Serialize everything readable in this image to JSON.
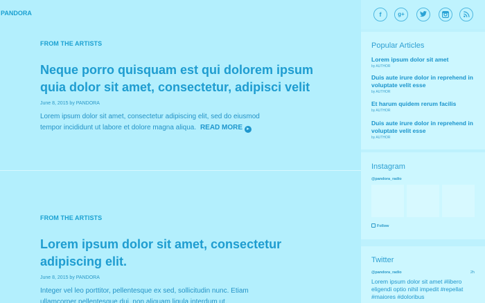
{
  "brand": {
    "logo": "PANDORA"
  },
  "articles": [
    {
      "category": "FROM THE ARTISTS",
      "title": "Neque porro quisquam est qui dolorem ipsum quia dolor sit amet, consectetur, adipisci velit",
      "meta": "June 8, 2015 by PANDORA",
      "excerpt": "Lorem ipsum dolor sit amet, consectetur adipiscing elit, sed do eiusmod tempor incididunt ut labore et dolore magna aliqua.",
      "read_more": "READ MORE"
    },
    {
      "category": "FROM THE ARTISTS",
      "title": "Lorem ipsum dolor sit amet, consectetur adipiscing elit.",
      "meta": "June 8, 2015 by PANDORA",
      "excerpt": "Integer vel leo porttitor, pellentesque ex sed, sollicitudin nunc. Etiam ullamcorper pellentesque dui, non aliquam ligula interdum ut."
    }
  ],
  "social": [
    {
      "icon": "facebook-icon",
      "glyph": "f"
    },
    {
      "icon": "google-plus-icon",
      "glyph": "g+"
    },
    {
      "icon": "twitter-icon",
      "glyph": ""
    },
    {
      "icon": "instagram-icon",
      "glyph": ""
    },
    {
      "icon": "rss-icon",
      "glyph": ""
    }
  ],
  "popular": {
    "title": "Popular Articles",
    "items": [
      {
        "title": "Lorem ipsum dolor sit amet",
        "by": "by AUTHOR"
      },
      {
        "title": "Duis aute irure dolor in reprehend in voluptate velit esse",
        "by": "by AUTHOR"
      },
      {
        "title": "Et harum quidem rerum facilis",
        "by": "by AUTHOR"
      },
      {
        "title": "Duis aute irure dolor in reprehend in voluptate velit esse",
        "by": "by AUTHOR"
      }
    ]
  },
  "instagram": {
    "title": "Instagram",
    "handle": "@pandora_radio",
    "follow": "Follow"
  },
  "twitter": {
    "title": "Twitter",
    "handle": "@pandora_radio",
    "time": "2h",
    "text": "Lorem ipsum dolor sit amet #libero eligendi optio nihil impedit #repellat #maiores #doloribus"
  },
  "colors": {
    "accent": "#1aa0d1",
    "background": "#b3effd",
    "sidebar": "#c9f6ff"
  }
}
